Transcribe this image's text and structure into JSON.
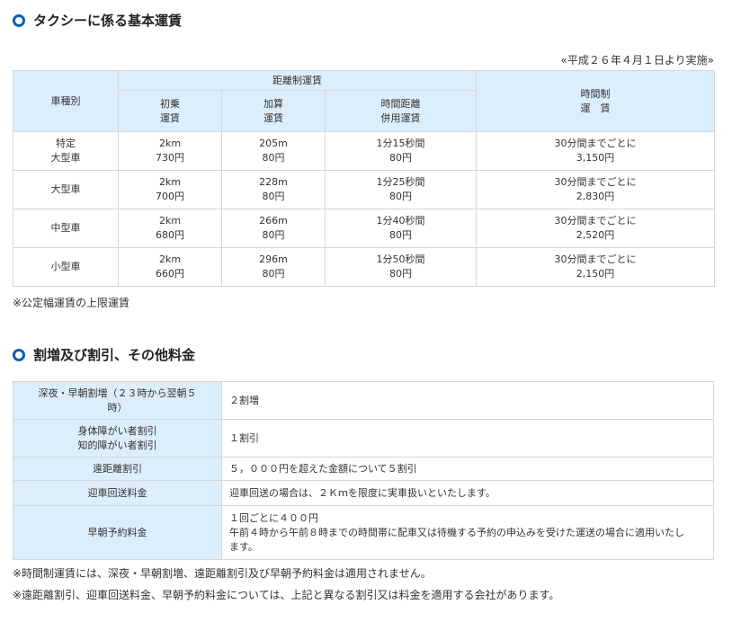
{
  "section1": {
    "title": "タクシーに係る基本運賃",
    "effective": "«平成２６年４月１日より実施»"
  },
  "fare_table": {
    "headers": {
      "vehicle": "車種別",
      "distance": "距離制運賃",
      "initial": [
        "初乗",
        "運賃"
      ],
      "add": [
        "加算",
        "運賃"
      ],
      "timedist": [
        "時間距離",
        "併用運賃"
      ],
      "time": [
        "時間制",
        "運　賃"
      ]
    },
    "rows": [
      {
        "type": [
          "特定",
          "大型車"
        ],
        "initial": [
          "2km",
          "730円"
        ],
        "add": [
          "205m",
          "80円"
        ],
        "timedist": [
          "1分15秒間",
          "80円"
        ],
        "time": [
          "30分間までごとに",
          "3,150円"
        ]
      },
      {
        "type": [
          "大型車"
        ],
        "initial": [
          "2km",
          "700円"
        ],
        "add": [
          "228m",
          "80円"
        ],
        "timedist": [
          "1分25秒間",
          "80円"
        ],
        "time": [
          "30分間までごとに",
          "2,830円"
        ]
      },
      {
        "type": [
          "中型車"
        ],
        "initial": [
          "2km",
          "680円"
        ],
        "add": [
          "266m",
          "80円"
        ],
        "timedist": [
          "1分40秒間",
          "80円"
        ],
        "time": [
          "30分間までごとに",
          "2,520円"
        ]
      },
      {
        "type": [
          "小型車"
        ],
        "initial": [
          "2km",
          "660円"
        ],
        "add": [
          "296m",
          "80円"
        ],
        "timedist": [
          "1分50秒間",
          "80円"
        ],
        "time": [
          "30分間までごとに",
          "2,150円"
        ]
      }
    ],
    "note": "※公定幅運賃の上限運賃"
  },
  "section2": {
    "title": "割増及び割引、その他料金"
  },
  "extra_table": {
    "rows": [
      {
        "label": [
          "深夜・早朝割増（２３時から翌朝５",
          "時）"
        ],
        "value": [
          "２割増"
        ]
      },
      {
        "label": [
          "身体障がい者割引",
          "知的障がい者割引"
        ],
        "value": [
          "１割引"
        ]
      },
      {
        "label": [
          "遠距離割引"
        ],
        "value": [
          "５，０００円を超えた金額について５割引"
        ]
      },
      {
        "label": [
          "迎車回送料金"
        ],
        "value": [
          "迎車回送の場合は、２Ｋｍを限度に実車扱いといたします。"
        ]
      },
      {
        "label": [
          "早朝予約料金"
        ],
        "value": [
          "１回ごとに４００円",
          "午前４時から午前８時までの時間帯に配車又は待機する予約の申込みを受けた運送の場合に適用いたし",
          "ます。"
        ]
      }
    ]
  },
  "footnotes": [
    "※時間制運賃には、深夜・早朝割増、遠距離割引及び早朝予約料金は適用されません。",
    "※遠距離割引、迎車回送料金、早朝予約料金については、上記と異なる割引又は料金を適用する会社があります。"
  ],
  "colors": {
    "accent": "#0a5fb4",
    "header_bg": "#dcedfb",
    "border": "#d6d6d6"
  }
}
